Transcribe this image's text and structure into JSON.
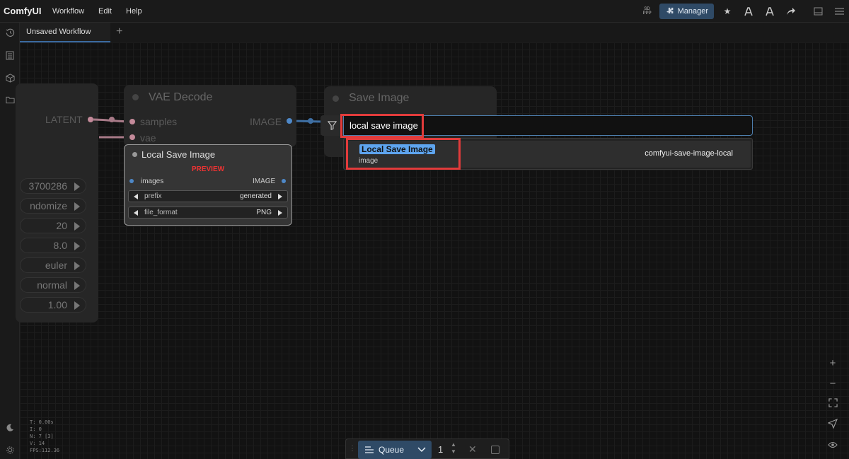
{
  "app": {
    "brand": "ComfyUI"
  },
  "menu": [
    "Workflow",
    "Edit",
    "Help"
  ],
  "toolbar": {
    "sdppp_line1": "SD",
    "sdppp_line2": "PPP",
    "manager_label": "Manager"
  },
  "tabs": [
    {
      "label": "Unsaved Workflow"
    }
  ],
  "nodes": {
    "left_partial": {
      "output_label": "LATENT",
      "widgets": [
        "3700286",
        "ndomize",
        "20",
        "8.0",
        "euler",
        "normal",
        "1.00"
      ]
    },
    "vae_decode": {
      "title": "VAE Decode",
      "inputs": [
        "samples",
        "vae"
      ],
      "output": "IMAGE"
    },
    "save_image": {
      "title": "Save Image"
    },
    "local_save_image": {
      "title": "Local Save Image",
      "preview_label": "PREVIEW",
      "input": "images",
      "output": "IMAGE",
      "widgets": [
        {
          "label": "prefix",
          "value": "generated"
        },
        {
          "label": "file_format",
          "value": "PNG"
        }
      ]
    }
  },
  "search": {
    "query": "local save image",
    "results": [
      {
        "name": "Local Save Image",
        "category": "image",
        "package": "comfyui-save-image-local"
      }
    ]
  },
  "stats": [
    "T: 0.00s",
    "I: 0",
    "N: 7 [3]",
    "V: 14",
    "FPS:112.36"
  ],
  "queue": {
    "label": "Queue",
    "count": "1"
  },
  "colors": {
    "accent": "#2f4a66",
    "highlight": "#e23b3b",
    "link_blue": "#4e7fae",
    "preview_red": "#e33333"
  }
}
